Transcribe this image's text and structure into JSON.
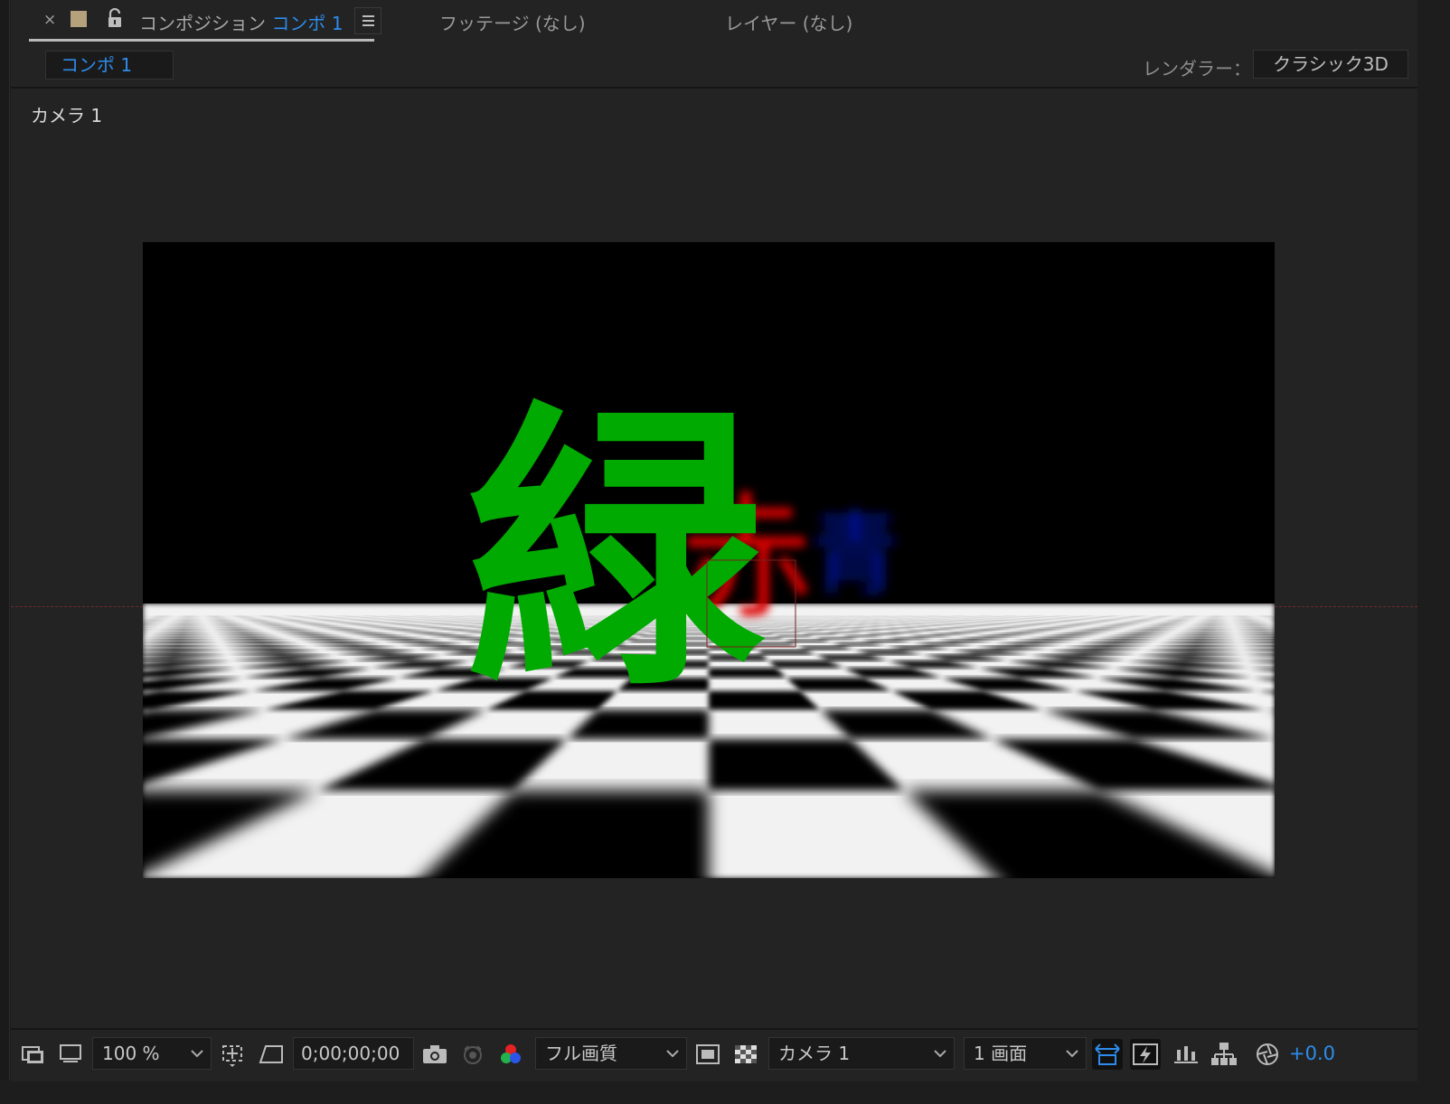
{
  "panel_tab": {
    "close_glyph": "×",
    "title_prefix": "コンポジション",
    "comp_name": "コンポ 1",
    "label_color": "#b5a27c"
  },
  "other_tabs": [
    {
      "label": "フッテージ (なし)"
    },
    {
      "label": "レイヤー (なし)"
    }
  ],
  "subbar": {
    "breadcrumb": "コンポ 1",
    "renderer_label": "レンダラー：",
    "renderer_value": "クラシック3D"
  },
  "viewer": {
    "camera_label": "カメラ 1",
    "scene_text": {
      "green": "緑",
      "red": "赤",
      "blue": "青"
    },
    "colors": {
      "green": "#00aa00",
      "red": "#dd0000",
      "blue": "#0a13a8"
    }
  },
  "toolbar": {
    "zoom": "100 %",
    "timecode": "0;00;00;00",
    "resolution": "フル画質",
    "view": "カメラ 1",
    "layout": "1 画面",
    "exposure": "+0.0",
    "accent": "#2d8ceb"
  }
}
